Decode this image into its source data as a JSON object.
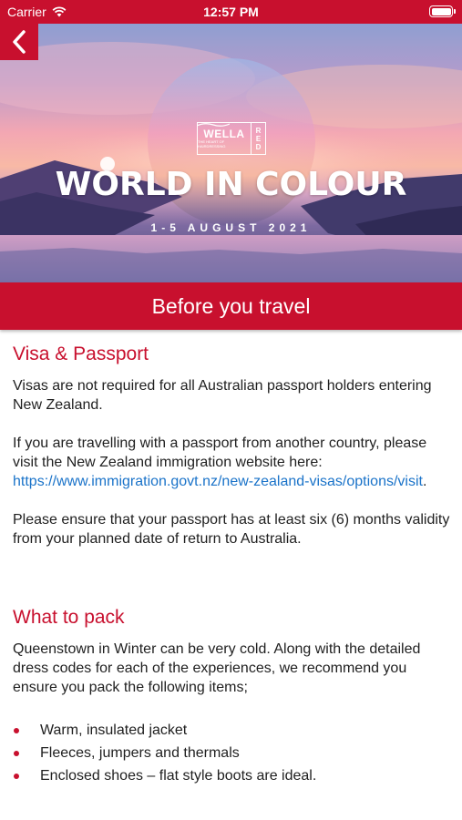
{
  "status_bar": {
    "carrier": "Carrier",
    "time": "12:57 PM"
  },
  "hero": {
    "logo_brand": "WELLA",
    "logo_tagline": "THE HEART OF HAIRDRESSING",
    "logo_red": [
      "R",
      "E",
      "D"
    ],
    "title": "WORLD IN COLOUR",
    "dates": "1-5 AUGUST 2021"
  },
  "banner": {
    "title": "Before you travel"
  },
  "visa": {
    "heading": "Visa & Passport",
    "para1": "Visas are not required for all Australian passport holders entering New Zealand.",
    "para2_text": "If you are travelling with a passport from another country, please visit the New Zealand immigration website here: ",
    "para2_link": "https://www.immigration.govt.nz/new-zealand-visas/options/visit",
    "para2_end": ".",
    "para3": "Please ensure that your passport has at least six (6) months validity from your planned date of return to Australia."
  },
  "pack": {
    "heading": "What to pack",
    "intro": "Queenstown in Winter can be very cold. Along with the detailed dress codes for each of the experiences, we recommend you ensure you pack the following items;",
    "items": [
      "Warm, insulated jacket",
      "Fleeces, jumpers and thermals",
      "Enclosed shoes – flat style boots are ideal."
    ]
  },
  "colors": {
    "brand_red": "#c8102e",
    "link_blue": "#1a73c9"
  },
  "icons": {
    "back": "chevron-left-icon",
    "wifi": "wifi-icon",
    "battery": "battery-icon"
  }
}
